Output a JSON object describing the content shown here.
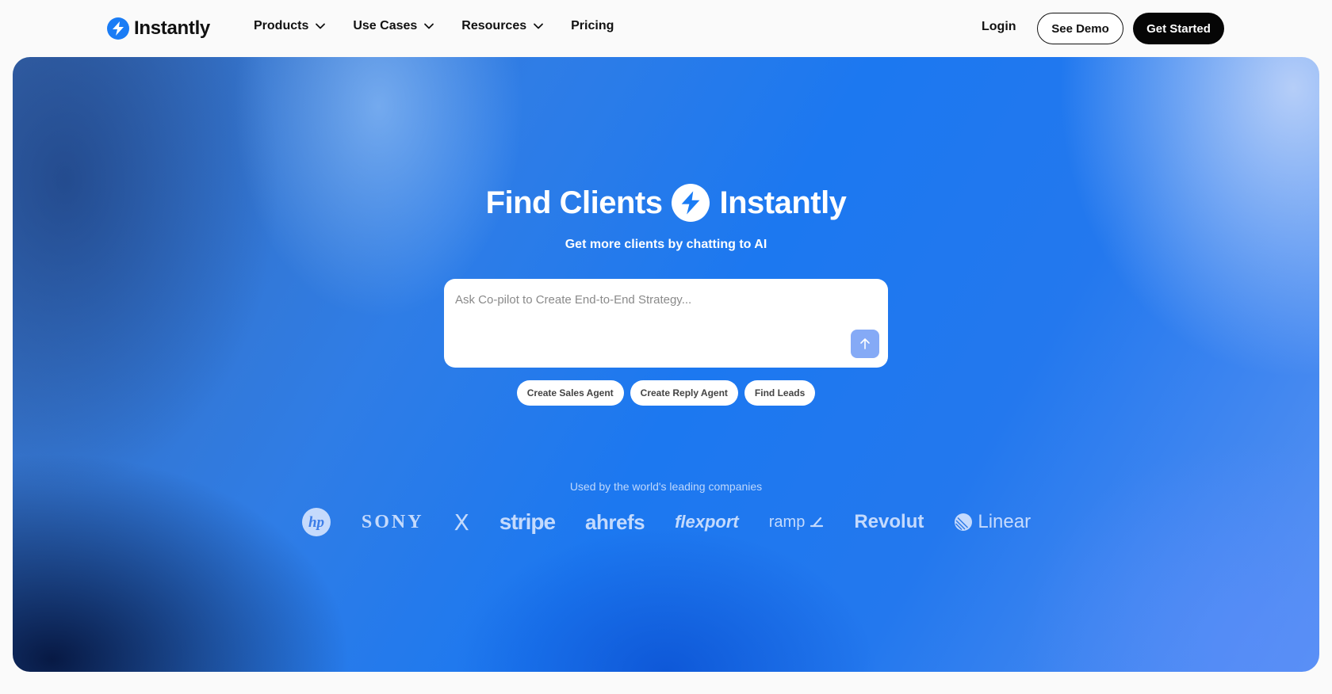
{
  "header": {
    "logo_text": "Instantly",
    "nav": [
      {
        "label": "Products"
      },
      {
        "label": "Use Cases"
      },
      {
        "label": "Resources"
      },
      {
        "label": "Pricing"
      }
    ],
    "login_label": "Login",
    "demo_label": "See Demo",
    "start_label": "Get Started"
  },
  "hero": {
    "title_left": "Find Clients",
    "title_right": "Instantly",
    "subtitle": "Get more clients by chatting to AI",
    "prompt_placeholder": "Ask Co-pilot to Create End-to-End Strategy...",
    "chips": [
      {
        "label": "Create Sales Agent"
      },
      {
        "label": "Create Reply Agent"
      },
      {
        "label": "Find Leads"
      }
    ],
    "used_by": "Used by the world's leading companies",
    "logos": [
      "hp",
      "SONY",
      "X",
      "stripe",
      "ahrefs",
      "flexport",
      "ramp",
      "Revolut",
      "Linear"
    ]
  },
  "colors": {
    "brand_blue": "#1a7cf5",
    "send_button": "#85aaf6",
    "dark_button": "#060606"
  },
  "icons": [
    "bolt-icon",
    "chevron-down-icon",
    "arrow-up-icon"
  ]
}
